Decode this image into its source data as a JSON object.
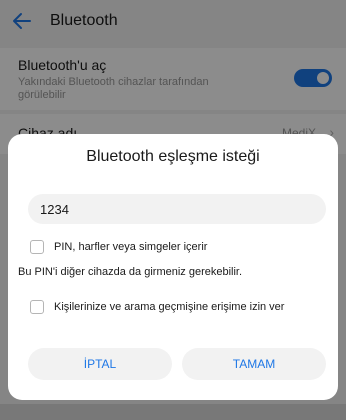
{
  "header": {
    "title": "Bluetooth"
  },
  "bluetooth_setting": {
    "title": "Bluetooth'u aç",
    "subtitle": "Yakındaki Bluetooth cihazlar tarafından görülebilir",
    "enabled": true
  },
  "device_name_row": {
    "label": "Cihaz adı",
    "value": "MediX"
  },
  "dialog": {
    "title": "Bluetooth eşleşme isteği",
    "pin_value": "1234",
    "pin_option_label": "PIN, harfler veya simgeler içerir",
    "info_text": "Bu PIN'i diğer cihazda da girmeniz gerekebilir.",
    "contacts_option_label": "Kişilerinize ve arama geçmişine erişime izin ver",
    "cancel_label": "İPTAL",
    "ok_label": "TAMAM"
  },
  "colors": {
    "accent": "#1e77e6"
  }
}
